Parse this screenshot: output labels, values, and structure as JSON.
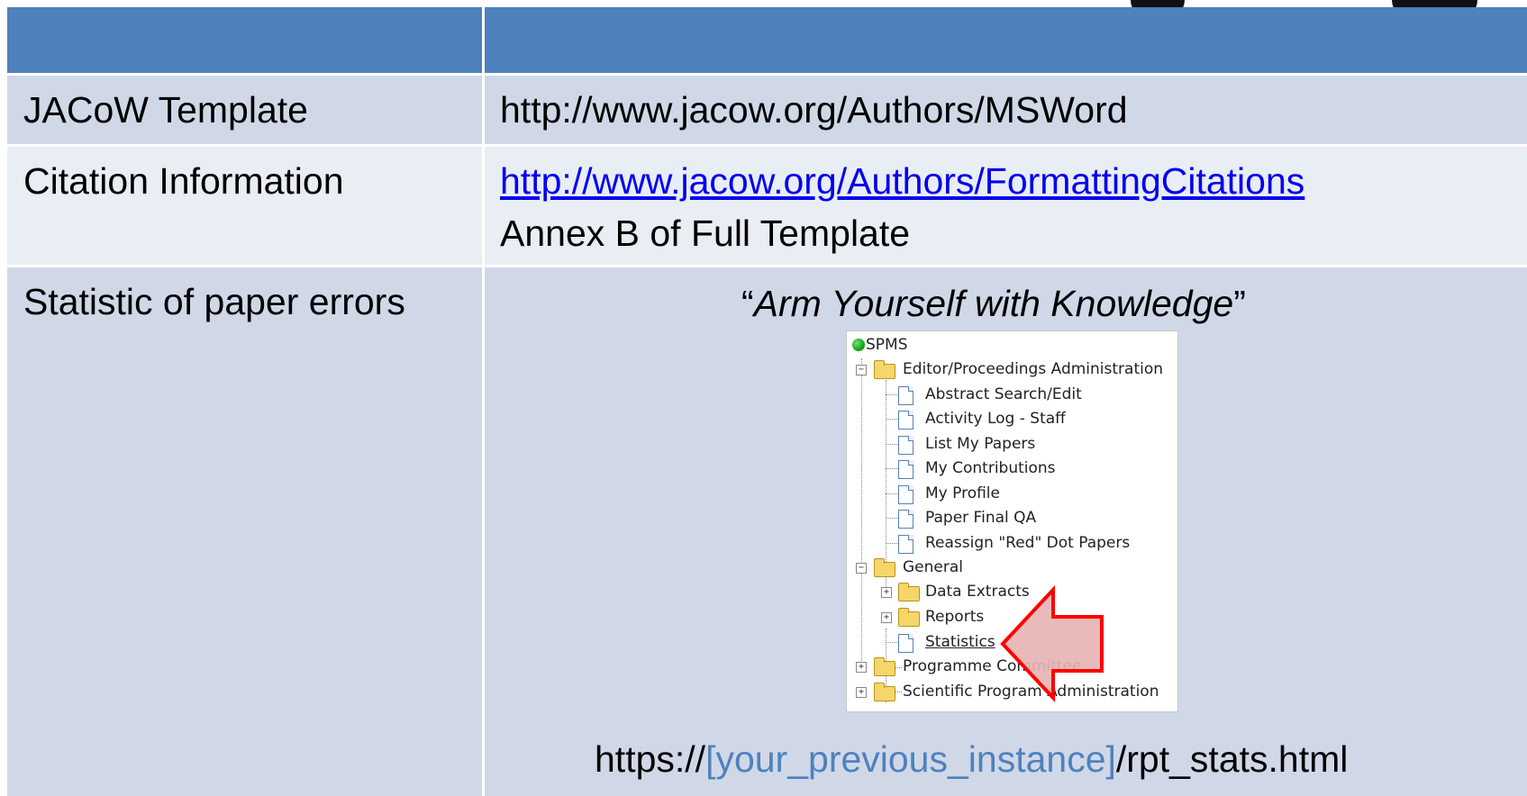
{
  "table": {
    "header": [
      "",
      ""
    ],
    "rows": [
      {
        "label": "JACoW Template",
        "lines": [
          "http://www.jacow.org/Authors/MSWord"
        ]
      },
      {
        "label": "Citation Information",
        "link": "http://www.jacow.org/Authors/FormattingCitations",
        "note": "Annex B of Full Template"
      },
      {
        "label": "Statistic of paper errors",
        "quote_open": "“",
        "quote_text": "Arm Yourself with Knowledge",
        "quote_close": "”",
        "url_prefix": "https://",
        "url_placeholder": "[your_previous_instance]",
        "url_suffix": "/rpt_stats.html"
      }
    ]
  },
  "spms_tree": {
    "root": "SPMS",
    "items": [
      "Editor/Proceedings Administration",
      "Abstract Search/Edit",
      "Activity Log - Staff",
      "List My Papers",
      "My Contributions",
      "My Profile",
      "Paper Final QA",
      "Reassign \"Red\" Dot Papers",
      "General",
      "Data Extracts",
      "Reports",
      "Statistics",
      "Programme Committee",
      "Scientific Program Administration"
    ],
    "expand_open": "−",
    "expand_closed": "+"
  },
  "colors": {
    "header": "#4f81bd",
    "row_dark": "#d0d8e8",
    "row_light": "#e9edf4",
    "link": "#0000ee",
    "arrow_fill": "#e8b4b4",
    "arrow_stroke": "#ff0000"
  }
}
